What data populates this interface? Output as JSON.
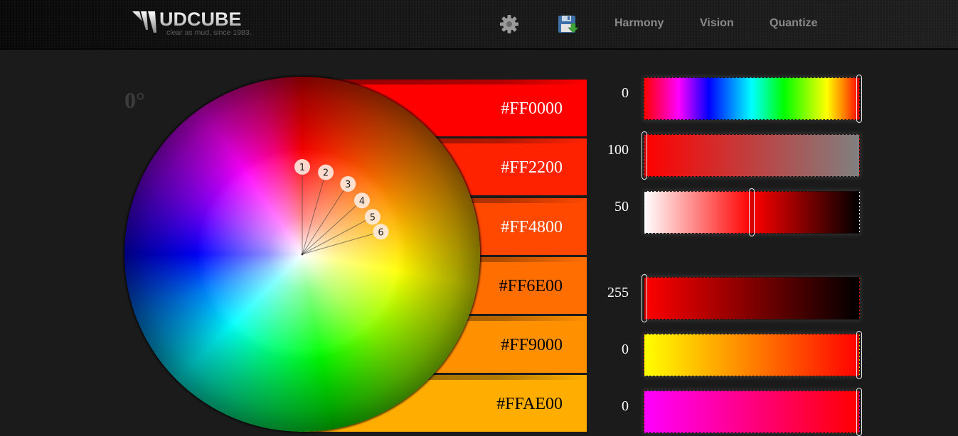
{
  "header": {
    "logo_text": "UDCUBE",
    "logo_mark": "M",
    "tagline": "clear as mud, since 1983.",
    "icons": [
      {
        "name": "settings-gear-icon"
      },
      {
        "name": "save-download-icon"
      }
    ],
    "nav": [
      "Harmony",
      "Vision",
      "Quantize"
    ]
  },
  "wheel": {
    "angle_label": "0°",
    "markers": [
      {
        "label": "1",
        "angle_deg": 0
      },
      {
        "label": "2",
        "angle_deg": 16
      },
      {
        "label": "3",
        "angle_deg": 33
      },
      {
        "label": "4",
        "angle_deg": 48
      },
      {
        "label": "5",
        "angle_deg": 62
      },
      {
        "label": "6",
        "angle_deg": 74
      }
    ]
  },
  "swatches": [
    {
      "hex": "#FF0000",
      "color": "#ff0000",
      "text_color": "#ffffff"
    },
    {
      "hex": "#FF2200",
      "color": "#ff2200",
      "text_color": "#ffffff"
    },
    {
      "hex": "#FF4800",
      "color": "#ff4800",
      "text_color": "#ffffff"
    },
    {
      "hex": "#FF6E00",
      "color": "#ff6e00",
      "text_color": "#000000"
    },
    {
      "hex": "#FF9000",
      "color": "#ff9000",
      "text_color": "#000000"
    },
    {
      "hex": "#FFAE00",
      "color": "#ffae00",
      "text_color": "#000000"
    }
  ],
  "sliders": [
    {
      "id": "hue",
      "value": "0",
      "position": 1.0,
      "gradient": "linear-gradient(90deg,#ff0000 0%,#ff00ff 16%,#0000ff 30%,#00ffff 50%,#00ff00 65%,#ffff00 85%,#ff8000 93%,#ff0000 100%)"
    },
    {
      "id": "saturation",
      "value": "100",
      "position": 0.0,
      "gradient": "linear-gradient(90deg,#ff0000 0%,#808080 100%)"
    },
    {
      "id": "lightness",
      "value": "50",
      "position": 0.5,
      "gradient": "linear-gradient(90deg,#ffffff 0%,#ff0000 50%,#000000 100%)"
    },
    {
      "id": "red",
      "value": "255",
      "position": 0.0,
      "gradient": "linear-gradient(90deg,#ff0000 0%,#000000 100%)"
    },
    {
      "id": "green",
      "value": "0",
      "position": 1.0,
      "gradient": "linear-gradient(90deg,#ffff00 0%,#ff0000 100%)"
    },
    {
      "id": "blue",
      "value": "0",
      "position": 1.0,
      "gradient": "linear-gradient(90deg,#ff00ff 0%,#ff0000 100%)"
    }
  ]
}
